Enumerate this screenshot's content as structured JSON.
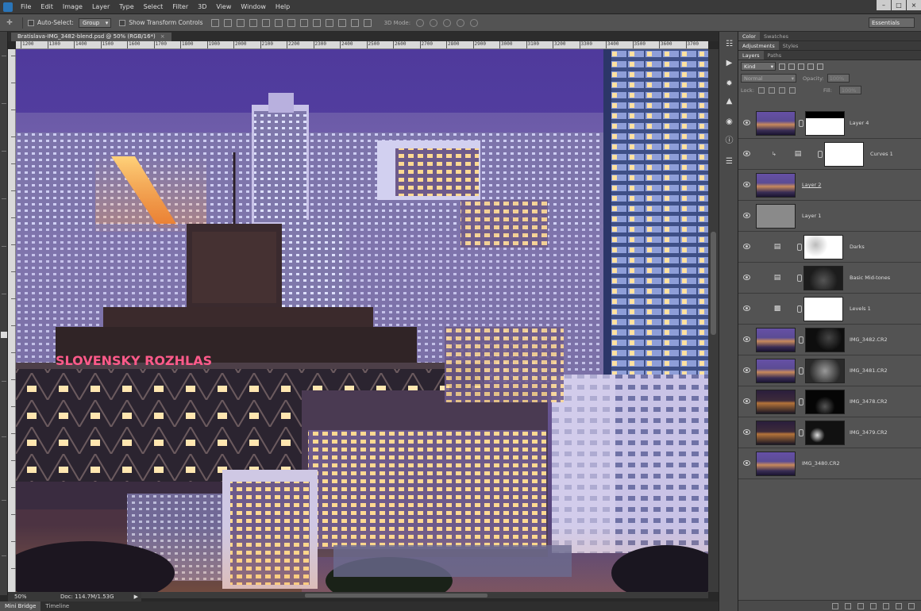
{
  "app": {
    "menu": [
      "File",
      "Edit",
      "Image",
      "Layer",
      "Type",
      "Select",
      "Filter",
      "3D",
      "View",
      "Window",
      "Help"
    ],
    "window_controls": [
      "–",
      "□",
      "×"
    ]
  },
  "options_bar": {
    "tool_glyph": "✛",
    "auto_select_label": "Auto-Select:",
    "auto_select_value": "Group",
    "show_transform_label": "Show Transform Controls",
    "mode_3d_label": "3D Mode:",
    "workspace": "Essentials"
  },
  "document": {
    "tab_title": "Bratislava-IMG_3482-blend.psd @ 50% (RGB/16*)",
    "tab_close": "×",
    "ruler_marks": [
      "1200",
      "1300",
      "1400",
      "1500",
      "1600",
      "1700",
      "1800",
      "1900",
      "2000",
      "2100",
      "2200",
      "2300",
      "2400",
      "2500",
      "2600",
      "2700",
      "2800",
      "2900",
      "3000",
      "3100",
      "3200",
      "3300",
      "3400",
      "3500",
      "3600",
      "3700",
      "3800"
    ],
    "canvas_sign_text": "SLOVENSKY ROZHLAS",
    "zoom": "50%",
    "doc_size": "Doc: 114.7M/1.53G",
    "status_arrow": "▶"
  },
  "bottom_tabs": [
    "Mini Bridge",
    "Timeline"
  ],
  "panels": {
    "top_tabs": [
      "Color",
      "Swatches"
    ],
    "mid_tabs": [
      "Adjustments",
      "Styles"
    ],
    "layer_tabs": [
      "Layers",
      "Paths"
    ],
    "kind_filter": "Kind",
    "blend_mode": "Normal",
    "opacity_label": "Opacity:",
    "opacity_value": "100%",
    "lock_label": "Lock:",
    "fill_label": "Fill:",
    "fill_value": "100%"
  },
  "layers": [
    {
      "name": "Layer 4",
      "type": "pixel_mask"
    },
    {
      "name": "Curves 1",
      "type": "adjustment_clipped"
    },
    {
      "name": "Layer 2",
      "type": "pixel"
    },
    {
      "name": "Layer 1",
      "type": "pixel_gray"
    },
    {
      "name": "Darks",
      "type": "adjustment_curves"
    },
    {
      "name": "Basic Mid-tones",
      "type": "adjustment_curves"
    },
    {
      "name": "Levels 1",
      "type": "adjustment_levels"
    },
    {
      "name": "IMG_3482.CR2",
      "type": "pixel_mask"
    },
    {
      "name": "IMG_3481.CR2",
      "type": "pixel_mask"
    },
    {
      "name": "IMG_3478.CR2",
      "type": "pixel_mask"
    },
    {
      "name": "IMG_3479.CR2",
      "type": "pixel_mask"
    },
    {
      "name": "IMG_3480.CR2",
      "type": "pixel"
    }
  ]
}
